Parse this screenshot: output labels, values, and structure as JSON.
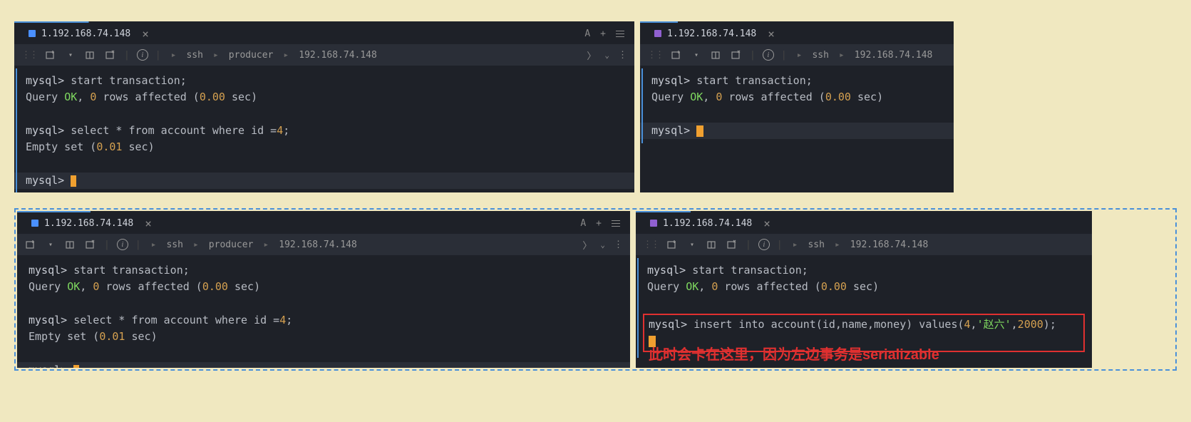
{
  "row1": {
    "left": {
      "tab": {
        "color": "blue",
        "label": "1.192.168.74.148"
      },
      "tabRightA": "A",
      "breadcrumb": [
        "ssh",
        "producer",
        "192.168.74.148"
      ],
      "lines": {
        "l1_prompt": "mysql> ",
        "l1_cmd": "start transaction;",
        "l2_a": "Query ",
        "l2_ok": "OK",
        "l2_b": ", ",
        "l2_n0": "0",
        "l2_c": " rows affected (",
        "l2_t": "0.00",
        "l2_d": " sec)",
        "l3_prompt": "mysql> ",
        "l3_cmd": "select * from account where id =",
        "l3_n": "4",
        "l3_e": ";",
        "l4_a": "Empty set (",
        "l4_t": "0.01",
        "l4_b": " sec)",
        "l5_prompt": "mysql> "
      }
    },
    "right": {
      "tab": {
        "color": "purple",
        "label": "1.192.168.74.148"
      },
      "breadcrumb": [
        "ssh",
        "192.168.74.148"
      ],
      "lines": {
        "l1_prompt": "mysql> ",
        "l1_cmd": "start transaction;",
        "l2_a": "Query ",
        "l2_ok": "OK",
        "l2_b": ", ",
        "l2_n0": "0",
        "l2_c": " rows affected (",
        "l2_t": "0.00",
        "l2_d": " sec)",
        "l3_prompt": "mysql> "
      }
    }
  },
  "row2": {
    "left": {
      "tab": {
        "color": "blue",
        "label": "1.192.168.74.148"
      },
      "tabRightA": "A",
      "breadcrumb": [
        "ssh",
        "producer",
        "192.168.74.148"
      ],
      "lines": {
        "l1_prompt": "mysql> ",
        "l1_cmd": "start transaction;",
        "l2_a": "Query ",
        "l2_ok": "OK",
        "l2_b": ", ",
        "l2_n0": "0",
        "l2_c": " rows affected (",
        "l2_t": "0.00",
        "l2_d": " sec)",
        "l3_prompt": "mysql> ",
        "l3_cmd": "select * from account where id =",
        "l3_n": "4",
        "l3_e": ";",
        "l4_a": "Empty set (",
        "l4_t": "0.01",
        "l4_b": " sec)",
        "l5_prompt": "mysql> "
      }
    },
    "right": {
      "tab": {
        "color": "purple",
        "label": "1.192.168.74.148"
      },
      "breadcrumb": [
        "ssh",
        "192.168.74.148"
      ],
      "lines": {
        "l1_prompt": "mysql> ",
        "l1_cmd": "start transaction;",
        "l2_a": "Query ",
        "l2_ok": "OK",
        "l2_b": ", ",
        "l2_n0": "0",
        "l2_c": " rows affected (",
        "l2_t": "0.00",
        "l2_d": " sec)",
        "l3_prompt": "mysql> ",
        "l3_cmd_a": "insert into account(id,name,money) values(",
        "l3_n1": "4",
        "l3_cm": ",",
        "l3_str": "'赵六'",
        "l3_cm2": ",",
        "l3_n2": "2000",
        "l3_cmd_b": ");"
      }
    },
    "annotation": "此时会卡在这里，因为左边事务是serializable"
  }
}
